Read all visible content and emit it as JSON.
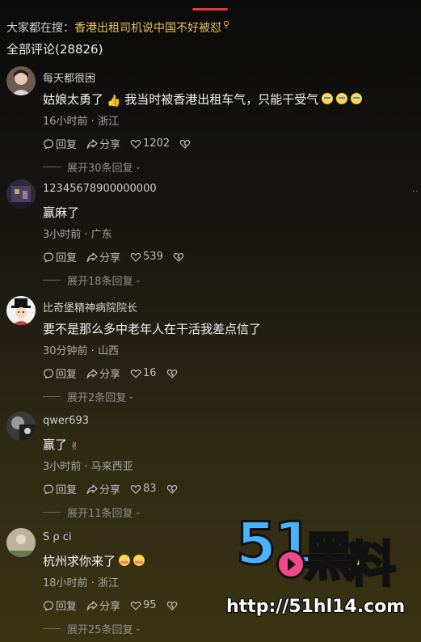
{
  "header": {
    "search_prefix": "大家都在搜：",
    "search_term": "香港出租司机说中国不好被怼",
    "total_label": "全部评论(28826)"
  },
  "icons": {
    "reply": "comment-bubble-icon",
    "share": "share-arrow-icon",
    "like": "heart-icon",
    "dislike": "broken-heart-icon"
  },
  "colors": {
    "search_link": "#e8c25a",
    "indicator": "#e03a4a"
  },
  "action_labels": {
    "reply": "回复",
    "share": "分享"
  },
  "comments": [
    {
      "user": "每天都很困",
      "text": "姑娘太勇了",
      "text2": "我当时被香港出租车气，只能干受气",
      "meta": "16小时前 · 浙江",
      "likes": "1202",
      "expand": "展开30条回复"
    },
    {
      "user": "12345678900000000",
      "text": "赢麻了",
      "meta": "3小时前 · 广东",
      "likes": "539",
      "expand": "展开18条回复"
    },
    {
      "user": "比奇堡精神病院院长",
      "text": "要不是那么多中老年人在干活我差点信了",
      "meta": "30分钟前 · 山西",
      "likes": "16",
      "expand": "展开2条回复"
    },
    {
      "user": "qwer693",
      "text": "赢了",
      "meta": "3小时前 · 马来西亚",
      "likes": "83",
      "expand": "展开11条回复"
    },
    {
      "user": "S ρ  ci",
      "text": "杭州求你来了",
      "meta": "18小时前 · 浙江",
      "likes": "95",
      "expand": "展开25条回复"
    }
  ],
  "watermark": {
    "logo_digits": "51",
    "logo_char1": "黑",
    "logo_char2": "料",
    "url": "http://51hl14.com"
  }
}
